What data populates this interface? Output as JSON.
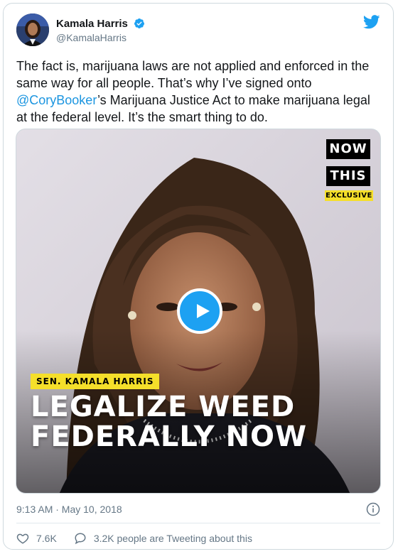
{
  "author": {
    "name": "Kamala Harris",
    "handle": "@KamalaHarris",
    "verified": true
  },
  "tweet": {
    "text_before": "The fact is, marijuana laws are not applied and enforced in the same way for all people. That’s why I’ve signed onto ",
    "mention": "@CoryBooker",
    "text_after": "’s Marijuana Justice Act to make marijuana legal at the federal level. It’s the smart thing to do."
  },
  "media": {
    "logo_line1": "NOW",
    "logo_line2": "THIS",
    "exclusive_label": "EXCLUSIVE",
    "name_label": "SEN. KAMALA HARRIS",
    "headline_line1": "LEGALIZE WEED",
    "headline_line2": "FEDERALLY NOW"
  },
  "meta": {
    "timestamp": "9:13 AM · May 10, 2018"
  },
  "actions": {
    "like_count": "7.6K",
    "comment_text": "3.2K people are Tweeting about this"
  },
  "colors": {
    "accent": "#1da1f2",
    "link": "#1b95e0",
    "muted": "#657786",
    "yellow": "#f5df2a"
  }
}
